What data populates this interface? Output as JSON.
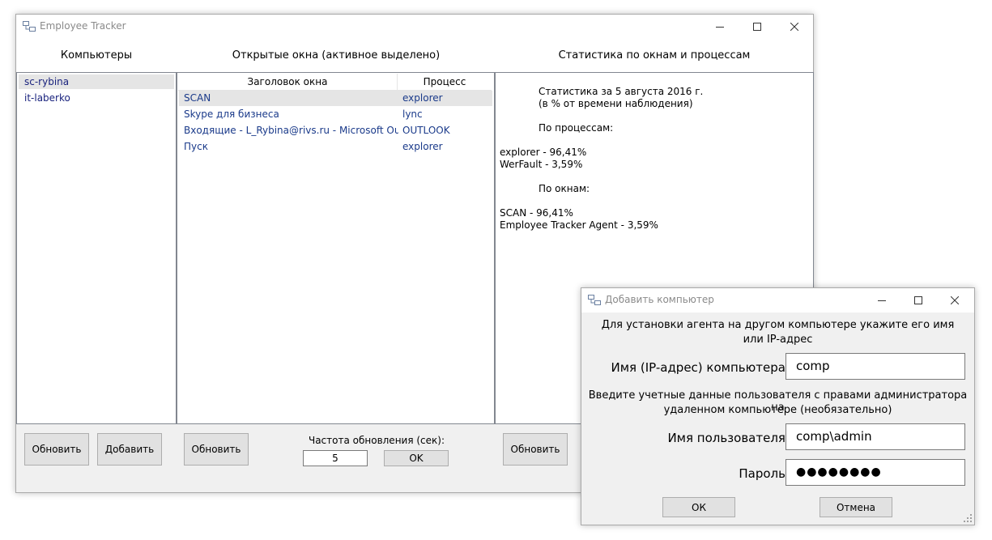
{
  "main_window": {
    "title": "Employee Tracker",
    "computers_header": "Компьютеры",
    "windows_header": "Открытые окна (активное выделено)",
    "stats_header": "Статистика по окнам и процессам",
    "computers": [
      "sc-rybina",
      "it-laberko"
    ],
    "windows_table": {
      "col_title": "Заголовок окна",
      "col_process": "Процесс",
      "rows": [
        {
          "title": "SCAN",
          "process": "explorer"
        },
        {
          "title": "Skype для бизнеса",
          "process": "lync"
        },
        {
          "title": "Входящие - L_Rybina@rivs.ru - Microsoft Outloo",
          "process": "OUTLOOK"
        },
        {
          "title": "Пуск",
          "process": "explorer"
        }
      ]
    },
    "stats": {
      "line1": "Статистика за 5 августа 2016 г.",
      "line2": "(в % от времени наблюдения)",
      "by_process_label": "По процессам:",
      "process_items": [
        "explorer - 96,41%",
        "WerFault - 3,59%"
      ],
      "by_window_label": "По окнам:",
      "window_items": [
        "SCAN - 96,41%",
        "Employee Tracker Agent - 3,59%"
      ]
    },
    "buttons": {
      "refresh_computers": "Обновить",
      "add": "Добавить",
      "refresh_windows": "Обновить",
      "refresh_stats": "Обновить",
      "ok": "OK"
    },
    "refresh_freq_label": "Частота обновления (сек):",
    "refresh_freq_value": "5"
  },
  "dialog": {
    "title": "Добавить компьютер",
    "intro_line1": "Для установки агента на другом компьютере укажите его имя",
    "intro_line2": "или IP-адрес",
    "host_label": "Имя (IP-адрес) компьютера:",
    "host_value": "comp",
    "creds_line1": "Введите учетные данные пользователя с правами администратора на",
    "creds_line2": "удаленном компьютере (необязательно)",
    "user_label": "Имя пользователя:",
    "user_value": "comp\\admin",
    "password_label": "Пароль:",
    "password_value": "●●●●●●●●",
    "ok": "ОК",
    "cancel": "Отмена"
  }
}
